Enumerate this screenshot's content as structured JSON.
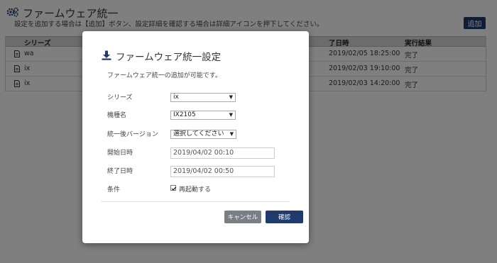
{
  "page": {
    "title": "ファームウェア統一",
    "subtitle": "設定を追加する場合は【追加】ボタン、設定詳細を確認する場合は詳細アイコンを押下してください。",
    "add_label": "追加",
    "columns": {
      "series": "シリーズ",
      "start_date": "了日時",
      "result": "実行結果"
    },
    "rows": [
      {
        "series": "wa",
        "date": "2019/02/05 18:25:00",
        "result": "完了"
      },
      {
        "series": "ix",
        "date": "2019/02/03 19:10:00",
        "result": "完了"
      },
      {
        "series": "ix",
        "date": "2019/02/03 14:20:00",
        "result": "完了"
      }
    ]
  },
  "modal": {
    "title": "ファームウェア統一設定",
    "description": "ファームウェア統一の追加が可能です。",
    "fields": {
      "series_label": "シリーズ",
      "series_value": "ix",
      "model_label": "機種名",
      "model_value": "IX2105",
      "version_label": "統一後バージョン",
      "version_value": "選択してください",
      "start_label": "開始日時",
      "start_value": "2019/04/02 00:10",
      "end_label": "終了日時",
      "end_value": "2019/04/02 00:50",
      "condition_label": "条件",
      "reboot_label": "再起動する",
      "reboot_checked": true
    },
    "cancel_label": "キャンセル",
    "ok_label": "確認"
  },
  "colors": {
    "primary": "#1f3b6e",
    "cancel": "#7a7f86",
    "overlay": "rgba(0,0,0,0.5)"
  }
}
